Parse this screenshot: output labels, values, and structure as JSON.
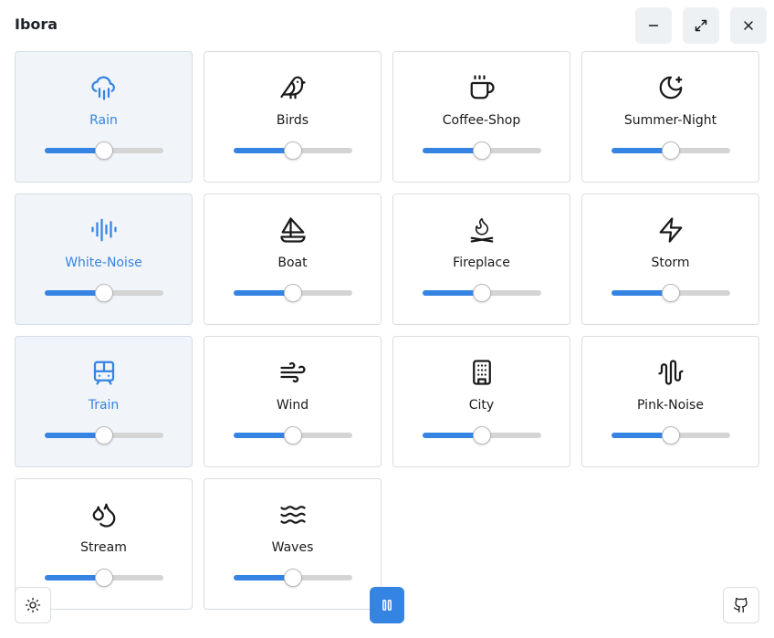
{
  "app": {
    "title": "Ibora"
  },
  "accent": "#3584e4",
  "window_controls": [
    {
      "name": "minimize-button",
      "icon": "minimize-icon"
    },
    {
      "name": "maximize-button",
      "icon": "maximize-icon"
    },
    {
      "name": "close-button",
      "icon": "close-icon"
    }
  ],
  "sounds": [
    {
      "label": "Rain",
      "icon": "rain-icon",
      "active": true,
      "volume": 0.5
    },
    {
      "label": "Birds",
      "icon": "bird-icon",
      "active": false,
      "volume": 0.5
    },
    {
      "label": "Coffee-Shop",
      "icon": "coffee-cup-icon",
      "active": false,
      "volume": 0.5
    },
    {
      "label": "Summer-Night",
      "icon": "moon-star-icon",
      "active": false,
      "volume": 0.5
    },
    {
      "label": "White-Noise",
      "icon": "audio-wave-icon",
      "active": true,
      "volume": 0.5
    },
    {
      "label": "Boat",
      "icon": "sailboat-icon",
      "active": false,
      "volume": 0.5
    },
    {
      "label": "Fireplace",
      "icon": "campfire-icon",
      "active": false,
      "volume": 0.5
    },
    {
      "label": "Storm",
      "icon": "lightning-icon",
      "active": false,
      "volume": 0.5
    },
    {
      "label": "Train",
      "icon": "train-icon",
      "active": true,
      "volume": 0.5
    },
    {
      "label": "Wind",
      "icon": "wind-icon",
      "active": false,
      "volume": 0.5
    },
    {
      "label": "City",
      "icon": "building-icon",
      "active": false,
      "volume": 0.5
    },
    {
      "label": "Pink-Noise",
      "icon": "pink-noise-wave-icon",
      "active": false,
      "volume": 0.5
    },
    {
      "label": "Stream",
      "icon": "droplets-icon",
      "active": false,
      "volume": 0.5
    },
    {
      "label": "Waves",
      "icon": "waves-icon",
      "active": false,
      "volume": 0.5
    }
  ],
  "footer": {
    "theme_icon": "sun-icon",
    "play_pause_icon": "pause-icon",
    "github_icon": "github-icon"
  }
}
